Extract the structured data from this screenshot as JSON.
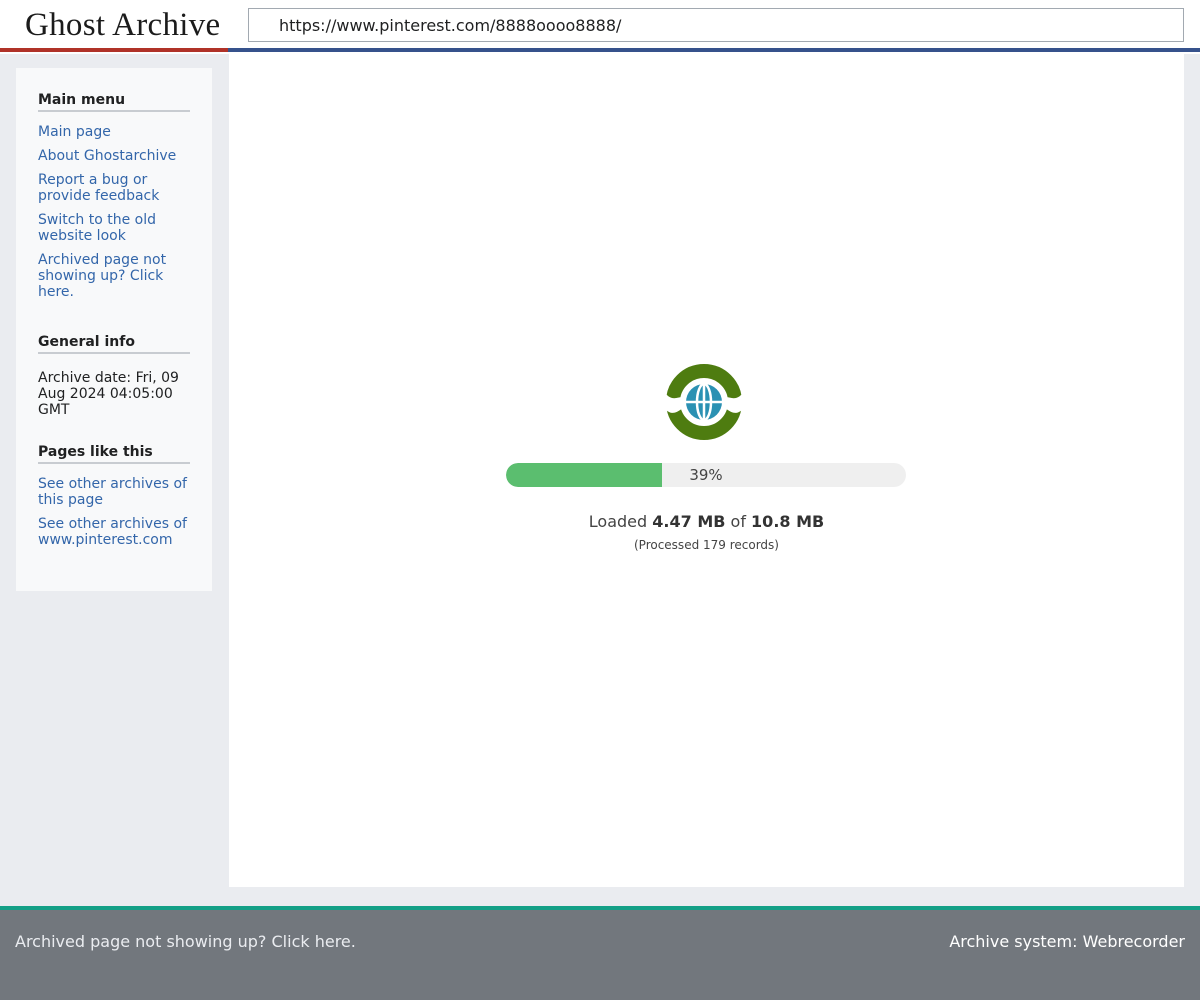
{
  "header": {
    "brand": "Ghost Archive",
    "url": "https://www.pinterest.com/8888oooo8888/"
  },
  "sidebar": {
    "main_menu_title": "Main menu",
    "main_menu": [
      "Main page",
      "About Ghostarchive",
      "Report a bug or provide feedback",
      "Switch to the old website look",
      "Archived page not showing up? Click here."
    ],
    "general_info_title": "General info",
    "archive_date": "Archive date: Fri, 09 Aug 2024 04:05:00 GMT",
    "similar_title": "Pages like this",
    "similar": [
      "See other archives of this page",
      "See other archives of www.pinterest.com"
    ]
  },
  "loader": {
    "icon": "globe-icon",
    "progress": 0.39,
    "percent_label": "39%",
    "loaded_prefix": "Loaded",
    "loaded_amount": "4.47 MB",
    "of_word": "of",
    "total_amount": "10.8 MB",
    "processed": "(Processed 179 records)"
  },
  "footer": {
    "left_link": "Archived page not showing up? Click here.",
    "right_text": "Archive system: Webrecorder"
  },
  "colors": {
    "brand_red": "#b03228",
    "url_blue": "#36528c",
    "link": "#3366aa",
    "progress_green": "#5bbe6f",
    "logo_green": "#4e7c10",
    "logo_globe": "#2b91b3",
    "footer_bg": "#72777d",
    "footer_accent": "#14a087"
  }
}
